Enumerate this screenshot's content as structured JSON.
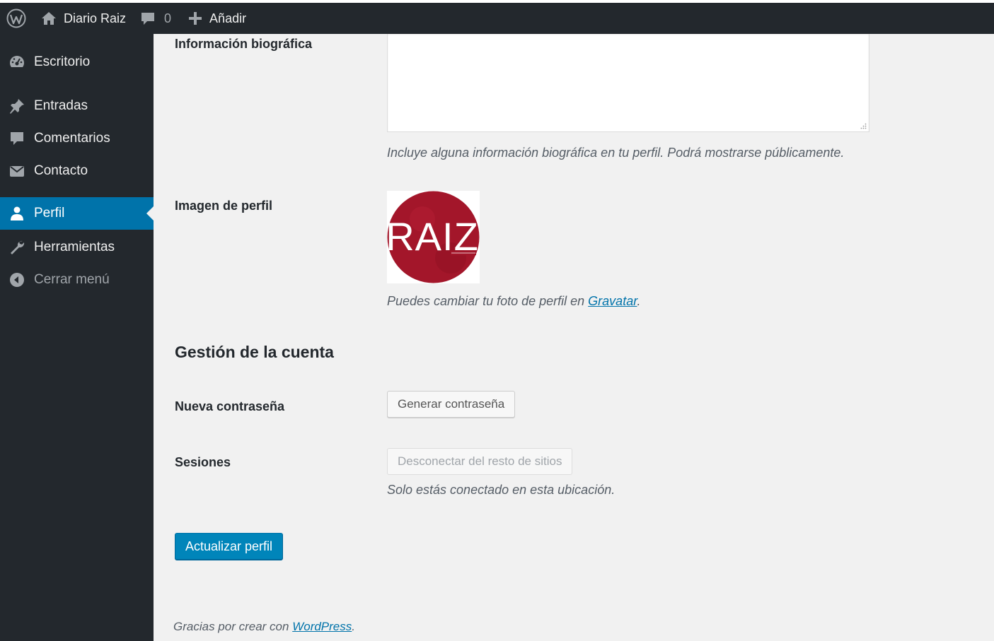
{
  "adminbar": {
    "site_name": "Diario Raiz",
    "comments_count": "0",
    "add_new_label": "Añadir"
  },
  "sidebar": {
    "items": [
      {
        "label": "Escritorio",
        "icon": "dashboard-icon"
      },
      {
        "label": "Entradas",
        "icon": "pin-icon"
      },
      {
        "label": "Comentarios",
        "icon": "comment-icon"
      },
      {
        "label": "Contacto",
        "icon": "mail-icon"
      },
      {
        "label": "Perfil",
        "icon": "user-icon",
        "active": true
      },
      {
        "label": "Herramientas",
        "icon": "wrench-icon"
      },
      {
        "label": "Cerrar menú",
        "icon": "collapse-icon"
      }
    ]
  },
  "form": {
    "bio_label": "Información biográfica",
    "bio_value": "",
    "bio_description": "Incluye alguna información biográfica en tu perfil. Podrá mostrarse públicamente.",
    "avatar_label": "Imagen de perfil",
    "avatar_logo_text": "RAIZ",
    "avatar_description_prefix": "Puedes cambiar tu foto de perfil en ",
    "avatar_link": "Gravatar",
    "avatar_description_suffix": ".",
    "account_section_title": "Gestión de la cuenta",
    "new_password_label": "Nueva contraseña",
    "generate_password_button": "Generar contraseña",
    "sessions_label": "Sesiones",
    "logout_everywhere_button": "Desconectar del resto de sitios",
    "sessions_description": "Solo estás conectado en esta ubicación.",
    "update_button": "Actualizar perfil"
  },
  "footer": {
    "prefix": "Gracias por crear con ",
    "link": "WordPress",
    "suffix": "."
  },
  "colors": {
    "adminbar_bg": "#23282d",
    "accent": "#0073aa",
    "primary_button": "#0085ba",
    "avatar_red": "#a3162a"
  }
}
